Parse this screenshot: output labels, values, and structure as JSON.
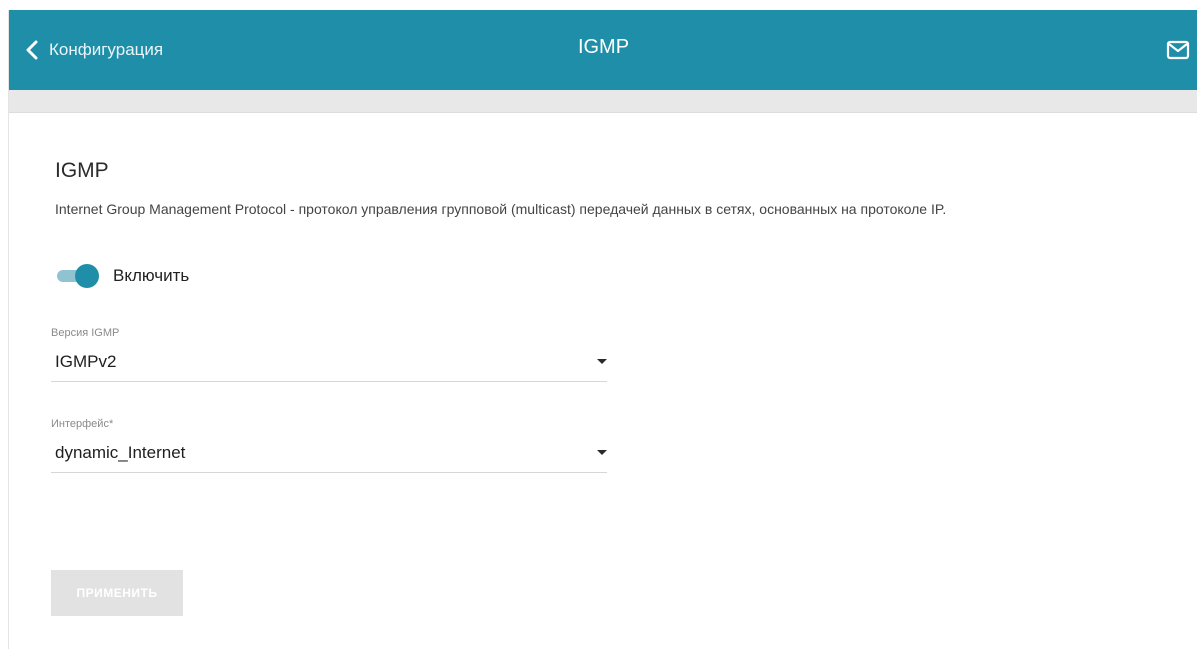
{
  "header": {
    "back_label": "Конфигурация",
    "title": "IGMP",
    "background_color": "#1f8ea8",
    "back_icon": "chevron-left-icon",
    "mail_icon": "mail-icon"
  },
  "section": {
    "title": "IGMP",
    "description": "Internet Group Management Protocol - протокол управления групповой (multicast) передачей данных в сетях, основанных на протоколе IP."
  },
  "enable_toggle": {
    "label": "Включить",
    "checked": true,
    "accent_color": "#1f8ea8"
  },
  "igmp_version": {
    "label": "Версия IGMP",
    "value": "IGMPv2"
  },
  "interface": {
    "label": "Интерфейс*",
    "value": "dynamic_Internet"
  },
  "apply_button": {
    "label": "ПРИМЕНИТЬ",
    "disabled": true
  }
}
